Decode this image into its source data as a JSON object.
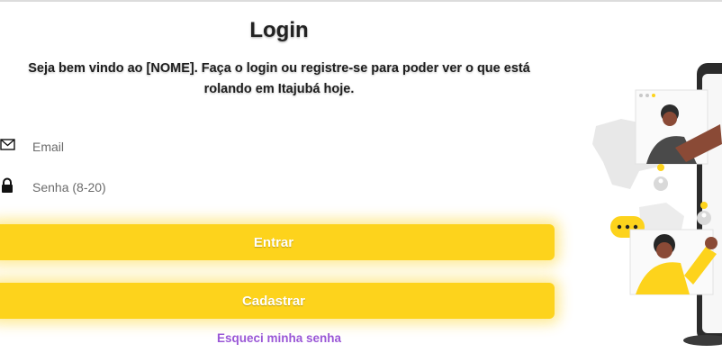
{
  "login": {
    "title": "Login",
    "subtitle_line1": "Seja bem vindo ao [NOME]. Faça o login ou registre-se para poder ver o que está",
    "subtitle_line2": "rolando em Itajubá hoje."
  },
  "form": {
    "email_placeholder": "Email",
    "password_placeholder": "Senha (8-20)",
    "email_icon": "envelope-icon",
    "password_icon": "lock-icon"
  },
  "actions": {
    "login_label": "Entrar",
    "register_label": "Cadastrar",
    "forgot_label": "Esqueci minha senha"
  },
  "colors": {
    "accent": "#fdd31c",
    "link": "#9a57d6"
  }
}
